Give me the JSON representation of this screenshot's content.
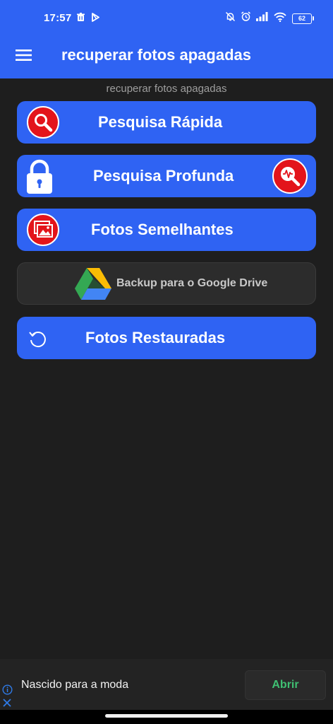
{
  "status_bar": {
    "time": "17:57",
    "battery": "62"
  },
  "app_bar": {
    "title": "recuperar fotos apagadas"
  },
  "subtitle": "recuperar fotos apagadas",
  "buttons": {
    "quick_search": "Pesquisa Rápida",
    "deep_search": "Pesquisa Profunda",
    "similar_photos": "Fotos Semelhantes",
    "drive_backup": "Backup para o Google Drive",
    "restored_photos": "Fotos Restauradas"
  },
  "icons": {
    "menu": "hamburger-menu-icon",
    "quick_search": "magnifier-icon",
    "lock": "padlock-icon",
    "deep_search": "magnifier-pulse-icon",
    "similar_photos": "photos-icon",
    "drive": "google-drive-icon",
    "restore": "restore-icon"
  },
  "colors": {
    "accent": "#2f63f3",
    "background": "#1e1e1e",
    "badge_red": "#e3141b",
    "ad_action": "#3fbf72"
  },
  "ad": {
    "text": "Nascido para a moda",
    "action": "Abrir"
  }
}
